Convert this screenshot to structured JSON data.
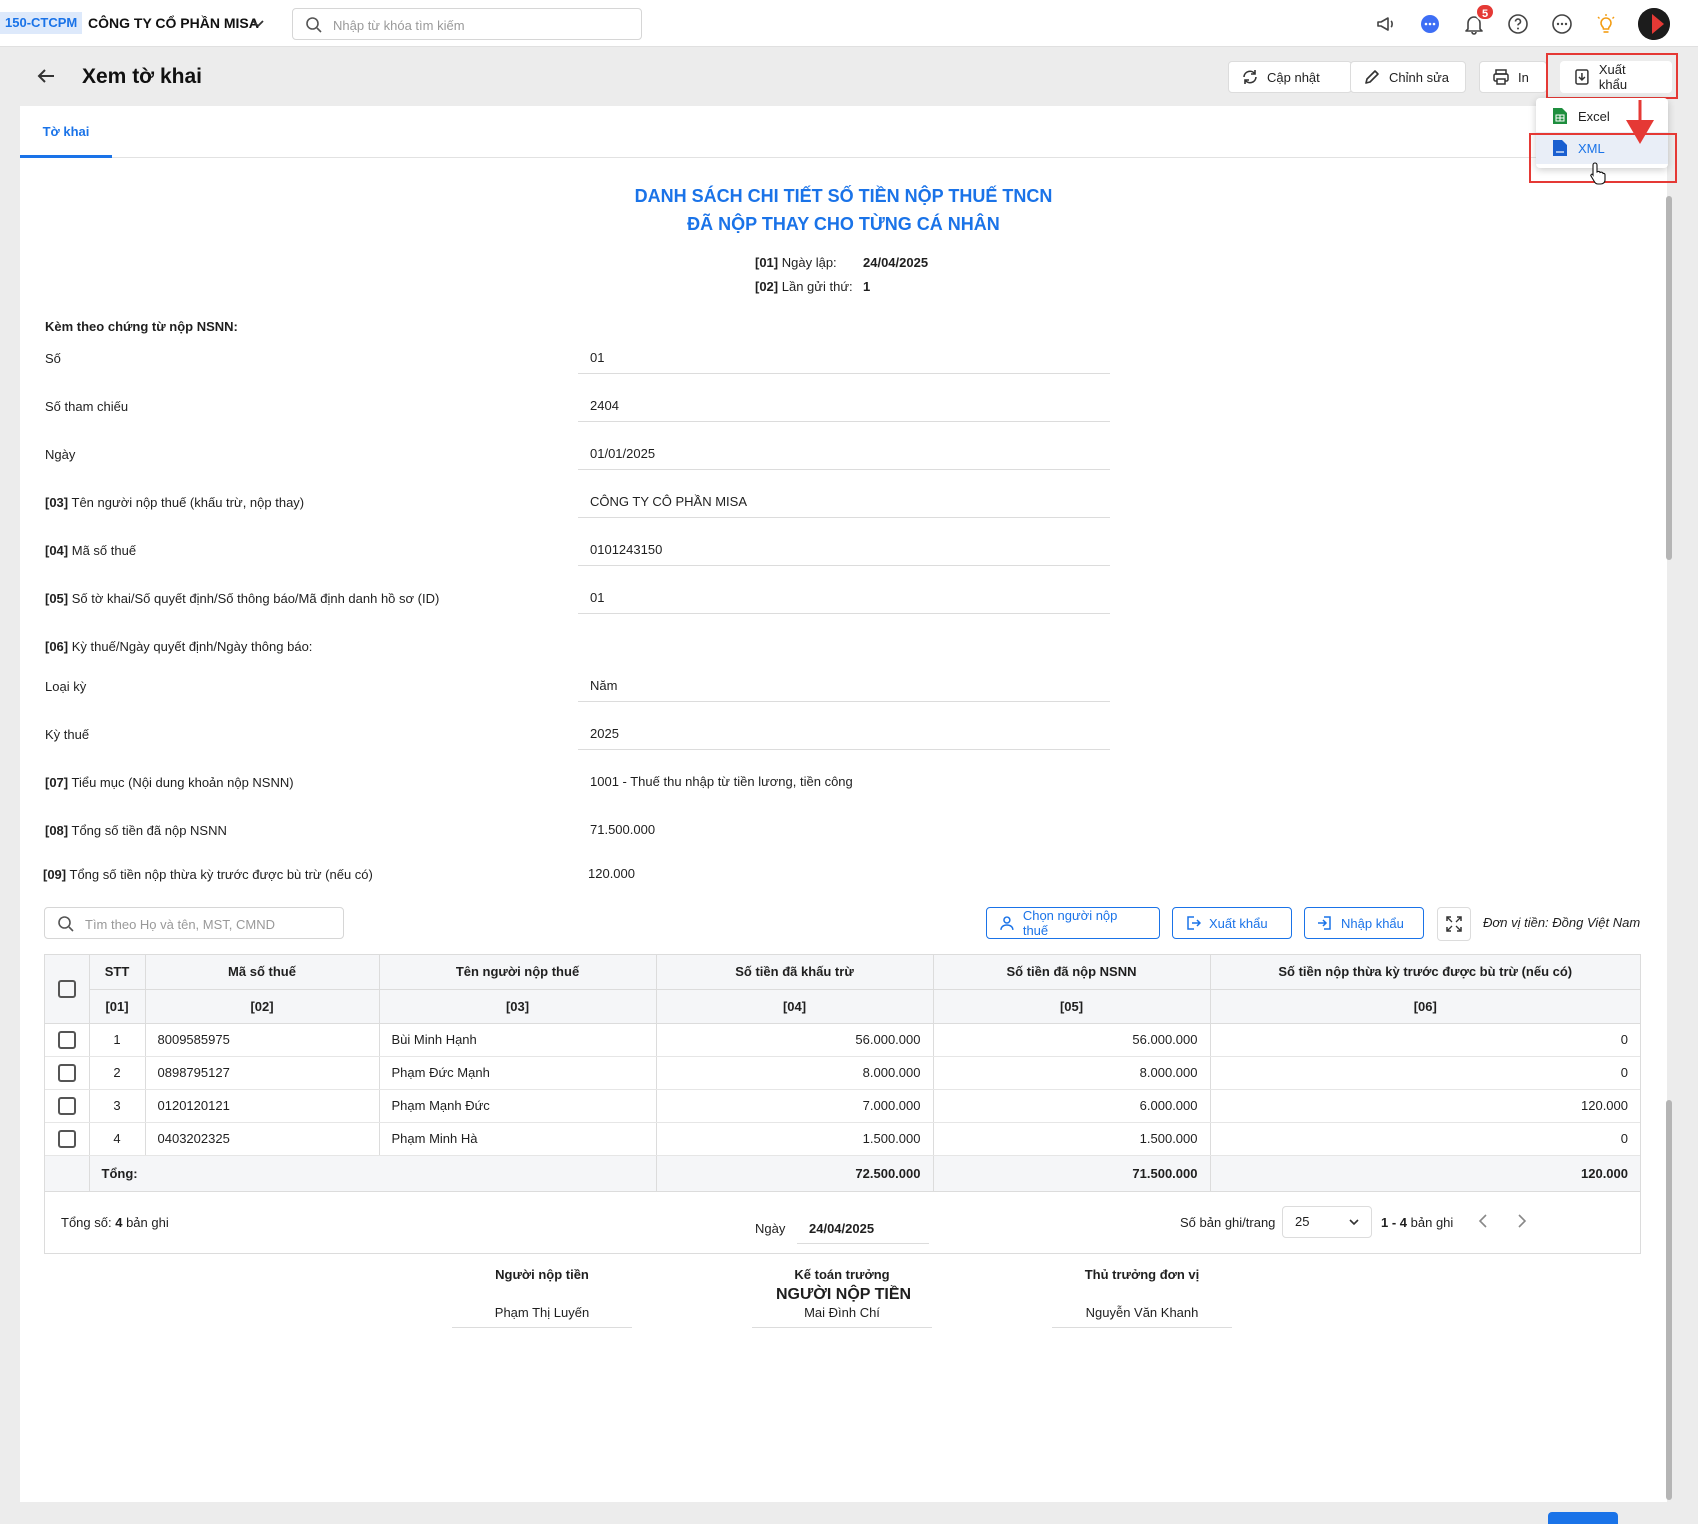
{
  "topbar": {
    "tenant_code": "150-CTCPM",
    "company": "CÔNG TY CỔ PHẦN MISA",
    "search_placeholder": "Nhập từ khóa tìm kiếm",
    "notification_count": "5"
  },
  "header": {
    "title": "Xem tờ khai",
    "btn_update": "Cập nhật",
    "btn_edit": "Chỉnh sửa",
    "btn_print": "In",
    "btn_export": "Xuất khẩu"
  },
  "export_menu": {
    "excel": "Excel",
    "xml": "XML"
  },
  "tabs": {
    "declaration": "Tờ khai"
  },
  "doc": {
    "title_line1": "DANH SÁCH CHI TIẾT SỐ TIỀN NỘP THUẾ TNCN",
    "title_line2": "ĐÃ NỘP THAY CHO TỪNG CÁ NHÂN",
    "f01_code": "[01]",
    "f01_label": "Ngày lập:",
    "f01_value": "24/04/2025",
    "f02_code": "[02]",
    "f02_label": "Lần gửi thứ:",
    "f02_value": "1",
    "attached_label": "Kèm theo chứng từ nộp NSNN:"
  },
  "fields": {
    "so_label": "Số",
    "so_value": "01",
    "ref_label": "Số tham chiếu",
    "ref_value": "2404",
    "date_label": "Ngày",
    "date_value": "01/01/2025",
    "f03_code": "[03]",
    "f03_label": "Tên người nộp thuế (khấu trừ, nộp thay)",
    "f03_value": "CÔNG TY CÔ PHẦN MISA",
    "f04_code": "[04]",
    "f04_label": "Mã số thuế",
    "f04_value": "0101243150",
    "f05_code": "[05]",
    "f05_label": "Số tờ khai/Số quyết định/Số thông báo/Mã định danh hồ sơ (ID)",
    "f05_value": "01",
    "f06_code": "[06]",
    "f06_label": "Kỳ thuế/Ngày quyết định/Ngày thông báo:",
    "period_type_label": "Loại kỳ",
    "period_type_value": "Năm",
    "period_label": "Kỳ thuế",
    "period_value": "2025",
    "f07_code": "[07]",
    "f07_label": "Tiểu mục (Nội dung khoản nộp NSNN)",
    "f07_value": "1001 - Thuế thu nhập từ tiền lương, tiền công",
    "f08_code": "[08]",
    "f08_label": "Tổng số tiền đã nộp NSNN",
    "f08_value": "71.500.000",
    "f09_code": "[09]",
    "f09_label": "Tổng số tiền nộp thừa kỳ trước được bù trừ (nếu có)",
    "f09_value": "120.000"
  },
  "table_toolbar": {
    "search_placeholder": "Tìm theo Họ và tên, MST, CMND",
    "btn_choose": "Chọn người nộp thuế",
    "btn_export": "Xuất khẩu",
    "btn_import": "Nhập khẩu",
    "unit": "Đơn vị tiền: Đồng Việt Nam"
  },
  "table": {
    "headers": [
      "STT",
      "Mã số thuế",
      "Tên người nộp thuế",
      "Số tiền đã khấu trừ",
      "Số tiền đã nộp NSNN",
      "Số tiền nộp thừa kỳ trước được bù trừ (nếu có)"
    ],
    "codes": [
      "[01]",
      "[02]",
      "[03]",
      "[04]",
      "[05]",
      "[06]"
    ],
    "rows": [
      [
        "1",
        "8009585975",
        "Bùi Minh Hạnh",
        "56.000.000",
        "56.000.000",
        "0"
      ],
      [
        "2",
        "0898795127",
        "Phạm Đức Mạnh",
        "8.000.000",
        "8.000.000",
        "0"
      ],
      [
        "3",
        "0120120121",
        "Phạm Mạnh Đức",
        "7.000.000",
        "6.000.000",
        "120.000"
      ],
      [
        "4",
        "0403202325",
        "Phạm Minh Hà",
        "1.500.000",
        "1.500.000",
        "0"
      ]
    ],
    "total_label": "Tổng:",
    "total_withheld": "72.500.000",
    "total_paid": "71.500.000",
    "total_offset": "120.000"
  },
  "pagination": {
    "total_prefix": "Tổng số:",
    "total_count": "4",
    "total_suffix": "bản ghi",
    "page_size_label": "Số bản ghi/trang",
    "page_size": "25",
    "range": "1 - 4",
    "range_suffix": "bản ghi"
  },
  "signature": {
    "title": "NGƯỜI NỘP TIỀN",
    "date_label": "Ngày",
    "date_value": "24/04/2025",
    "payer_role": "Người nộp tiền",
    "payer_name": "Phạm Thị Luyến",
    "accountant_role": "Kế toán trưởng",
    "accountant_name": "Mai Đình Chí",
    "head_role": "Thủ trưởng đơn vị",
    "head_name": "Nguyễn Văn Khanh"
  },
  "colors": {
    "accent": "#1a73e8",
    "highlight": "#e53935",
    "excel": "#1e8e3e"
  }
}
